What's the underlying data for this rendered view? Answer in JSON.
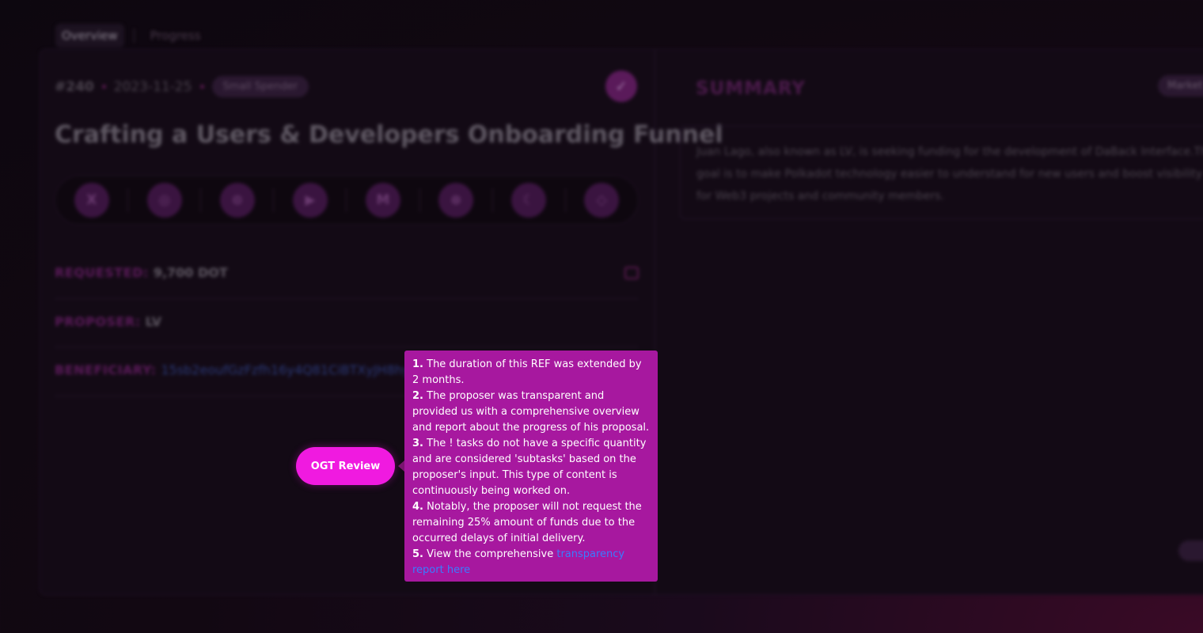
{
  "tabs": {
    "overview": "Overview",
    "progress": "Progress"
  },
  "proposal": {
    "id": "#240",
    "date": "2023-11-25",
    "track": "Small Spender",
    "title": "Crafting a Users & Developers Onboarding Funnel"
  },
  "socials": [
    {
      "icon": "x-icon",
      "glyph": "X"
    },
    {
      "icon": "globe-icon",
      "glyph": "◎"
    },
    {
      "icon": "github-icon",
      "glyph": "⊙"
    },
    {
      "icon": "youtube-icon",
      "glyph": "▶"
    },
    {
      "icon": "medium-icon",
      "glyph": "M"
    },
    {
      "icon": "discord-icon",
      "glyph": "⊛"
    },
    {
      "icon": "moon-icon",
      "glyph": "☾"
    },
    {
      "icon": "diamond-icon",
      "glyph": "◇"
    }
  ],
  "details": {
    "requested_label": "REQUESTED:",
    "requested_value": "9,700 DOT",
    "proposer_label": "PROPOSER:",
    "proposer_value": "LV",
    "beneficiary_label": "BENEFICIARY:",
    "beneficiary_value": "15sb2eoufGzFzfh16y4Q81CiBTXyJH8hy"
  },
  "summary": {
    "title": "SUMMARY",
    "badge": "Market",
    "text": "Juan Lago, also known as LV, is seeking funding for the development of DaBack Interface.The goal is to make Polkadot technology easier to understand for new users and boost visibility for Web3 projects and community members."
  },
  "review_button": "OGT Review",
  "tooltip": {
    "items": [
      {
        "num": "1.",
        "text": "The duration of this REF was extended by 2 months."
      },
      {
        "num": "2.",
        "text": "The proposer was transparent and provided us with a comprehensive overview and report about the progress of his proposal."
      },
      {
        "num": "3.",
        "text": "The ! tasks do not have a specific quantity and are considered 'subtasks' based on the proposer's input. This type of content is continuously being worked on."
      },
      {
        "num": "4.",
        "text": "Notably, the proposer will not request the remaining 25% amount of funds due to the occurred delays of initial delivery."
      }
    ],
    "item5_num": "5.",
    "item5_text": "View the comprehensive",
    "item5_link": "transparency report here"
  }
}
